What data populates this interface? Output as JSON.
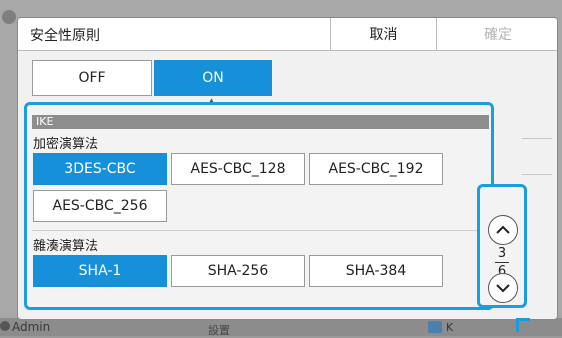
{
  "background": {
    "admin_label": "Admin",
    "center_label": "設置",
    "right_label": "K"
  },
  "dialog": {
    "title": "安全性原則",
    "cancel_label": "取消",
    "ok_label": "確定",
    "toggle": {
      "off_label": "OFF",
      "on_label": "ON",
      "selected": "ON"
    }
  },
  "ike": {
    "section_label": "IKE",
    "encryption": {
      "label": "加密演算法",
      "options": [
        "3DES-CBC",
        "AES-CBC_128",
        "AES-CBC_192",
        "AES-CBC_256"
      ],
      "selected": "3DES-CBC"
    },
    "hash": {
      "label": "雜湊演算法",
      "options": [
        "SHA-1",
        "SHA-256",
        "SHA-384"
      ],
      "selected": "SHA-1"
    }
  },
  "pager": {
    "current": "3",
    "total": "6"
  },
  "colors": {
    "accent": "#1690d8",
    "focus_border": "#1a9ee0"
  },
  "icons": {
    "scroll_up": "chevron-up-icon",
    "scroll_down": "chevron-down-icon"
  }
}
